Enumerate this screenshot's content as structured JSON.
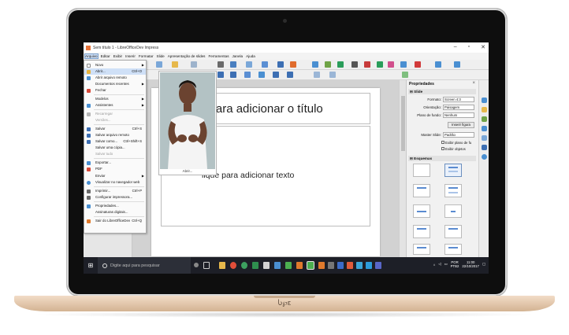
{
  "window": {
    "title": "Sem título 1 - LibreOfficeDev Impress",
    "minimize": "–",
    "maximize": "▫",
    "close": "✕"
  },
  "menubar": [
    "Arquivo",
    "Editar",
    "Exibir",
    "Inserir",
    "Formatar",
    "Slide",
    "Apresentação de slides",
    "Ferramentas",
    "Janela",
    "Ajuda"
  ],
  "file_menu": {
    "items": [
      {
        "label": "Novo",
        "shortcut": "",
        "submenu": true,
        "disabled": false,
        "icon": "new-document-icon",
        "color": "#ffffff"
      },
      {
        "label": "Abrir...",
        "shortcut": "Ctrl+O",
        "submenu": false,
        "disabled": false,
        "highlighted": true,
        "icon": "open-folder-icon",
        "color": "#e9b33c"
      },
      {
        "label": "Abrir arquivo remoto",
        "shortcut": "",
        "submenu": false,
        "disabled": false,
        "icon": "open-remote-icon",
        "color": "#4a8fd1"
      },
      {
        "label": "Documentos recentes",
        "shortcut": "",
        "submenu": true,
        "disabled": false,
        "icon": "",
        "color": ""
      },
      {
        "label": "Fechar",
        "shortcut": "",
        "submenu": false,
        "disabled": false,
        "icon": "close-document-icon",
        "color": "#d74a3a"
      },
      {
        "label": "Modelos",
        "shortcut": "",
        "submenu": true,
        "disabled": false,
        "icon": "",
        "color": ""
      },
      {
        "label": "Assistentes",
        "shortcut": "",
        "submenu": true,
        "disabled": false,
        "icon": "wizard-icon",
        "color": "#4a8fd1"
      },
      {
        "label": "Recarregar",
        "shortcut": "",
        "submenu": false,
        "disabled": true,
        "icon": "reload-icon",
        "color": "#b5b5b5"
      },
      {
        "label": "Versões...",
        "shortcut": "",
        "submenu": false,
        "disabled": true,
        "icon": "",
        "color": ""
      },
      {
        "label": "Salvar",
        "shortcut": "Ctrl+S",
        "submenu": false,
        "disabled": false,
        "icon": "save-icon",
        "color": "#3d6fb3"
      },
      {
        "label": "Salvar arquivo remoto",
        "shortcut": "",
        "submenu": false,
        "disabled": false,
        "icon": "save-remote-icon",
        "color": "#3d6fb3"
      },
      {
        "label": "Salvar como...",
        "shortcut": "Ctrl+Shift+S",
        "submenu": false,
        "disabled": false,
        "icon": "save-as-icon",
        "color": "#3d6fb3"
      },
      {
        "label": "Salvar uma cópia...",
        "shortcut": "",
        "submenu": false,
        "disabled": false,
        "icon": "",
        "color": ""
      },
      {
        "label": "Salvar tudo",
        "shortcut": "",
        "submenu": false,
        "disabled": true,
        "icon": "",
        "color": ""
      },
      {
        "label": "Exportar...",
        "shortcut": "",
        "submenu": false,
        "disabled": false,
        "icon": "export-icon",
        "color": "#4a8fd1"
      },
      {
        "label": "PDF",
        "shortcut": "",
        "submenu": false,
        "disabled": false,
        "icon": "pdf-icon",
        "color": "#d74a3a"
      },
      {
        "label": "Enviar",
        "shortcut": "",
        "submenu": true,
        "disabled": false,
        "icon": "",
        "color": ""
      },
      {
        "label": "Visualizar no navegador web",
        "shortcut": "",
        "submenu": false,
        "disabled": false,
        "icon": "web-preview-icon",
        "color": "#4a8fd1"
      },
      {
        "label": "Imprimir...",
        "shortcut": "Ctrl+P",
        "submenu": false,
        "disabled": false,
        "icon": "print-icon",
        "color": "#6a6a6a"
      },
      {
        "label": "Configurar impressora...",
        "shortcut": "",
        "submenu": false,
        "disabled": false,
        "icon": "printer-settings-icon",
        "color": "#6a6a6a"
      },
      {
        "label": "Propriedades...",
        "shortcut": "",
        "submenu": false,
        "disabled": false,
        "icon": "properties-icon",
        "color": "#4a8fd1"
      },
      {
        "label": "Assinaturas digitais...",
        "shortcut": "",
        "submenu": false,
        "disabled": false,
        "icon": "",
        "color": ""
      },
      {
        "label": "Sair do LibreOfficeDev",
        "shortcut": "Ctrl+Q",
        "submenu": false,
        "disabled": false,
        "icon": "exit-icon",
        "color": "#e07a2c"
      }
    ]
  },
  "slide": {
    "title_placeholder": "e para adicionar o título",
    "content_placeholder": "lique para adicionar texto"
  },
  "video": {
    "caption": "Abrir..."
  },
  "sidebar": {
    "header": "Propriedades",
    "section_slide": "Slide",
    "fields": [
      {
        "label": "Formato:",
        "value": "Screen 4:3"
      },
      {
        "label": "Orientação:",
        "value": "Paisagem"
      },
      {
        "label": "Plano de fundo:",
        "value": "Nenhum"
      }
    ],
    "insert_button": "Inserir figura",
    "master_label": "Master Slide:",
    "master_value": "Padrão",
    "checkboxes": [
      "Exibir plano de fu",
      "Exibir objetos"
    ],
    "section_layouts": "Esquemas"
  },
  "taskbar": {
    "search_placeholder": "Digite aqui para pesquisar",
    "lang_line1": "POR",
    "lang_line2": "PTB2",
    "time": "11:00",
    "date": "22/10/2017"
  },
  "brand": "Ⴑ℘ɛ",
  "colors": {
    "menu_highlight": "#cfe0f7",
    "taskbar": "#1d1f27",
    "laptop_gold": "#d3b392"
  }
}
